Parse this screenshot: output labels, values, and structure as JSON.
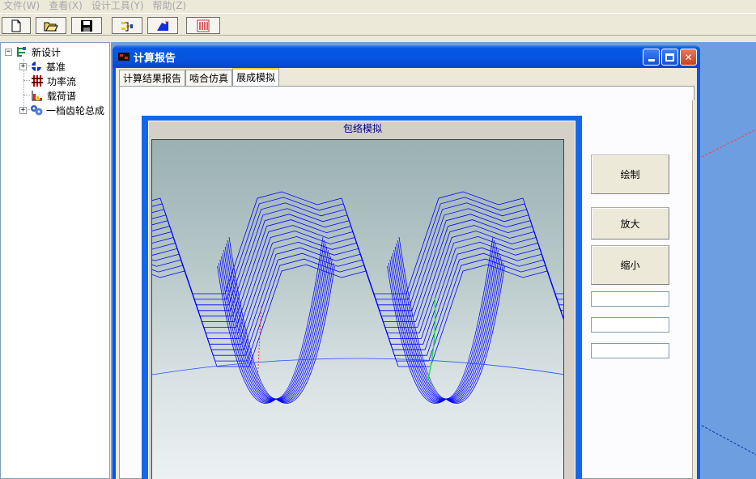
{
  "menu": [
    "文件(W)",
    "查看(X)",
    "设计工具(Y)",
    "帮助(Z)"
  ],
  "toolbar": {
    "buttons": [
      "new-file",
      "open-folder",
      "save-disk",
      "design-tool",
      "gear-wizard",
      "report"
    ]
  },
  "tree": {
    "root": "新设计",
    "items": [
      "基准",
      "功率流",
      "载荷谱",
      "一档齿轮总成"
    ]
  },
  "dialog": {
    "title": "计算报告",
    "tabs": [
      "计算结果报告",
      "啮合仿真",
      "展成模拟"
    ],
    "active_tab": 2,
    "panel_title": "包络模拟",
    "buttons": {
      "draw": "绘制",
      "zoom_in": "放大",
      "zoom_out": "缩小"
    },
    "inputs": [
      "",
      "",
      ""
    ]
  },
  "colors": {
    "curve": "#0000FF",
    "highlight_red": "#FF3030",
    "highlight_green": "#20E040",
    "accent_titlebar": "#0454E0"
  }
}
